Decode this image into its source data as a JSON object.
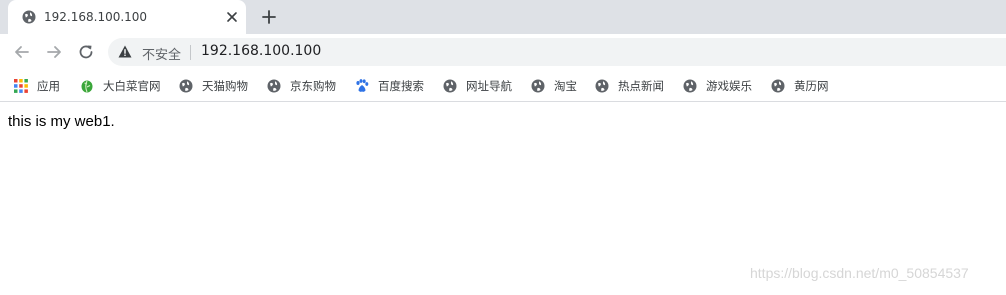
{
  "tab": {
    "title": "192.168.100.100",
    "favicon": "globe-icon"
  },
  "toolbar": {
    "insecure_label": "不安全",
    "url": "192.168.100.100"
  },
  "bookmarks": [
    {
      "label": "应用",
      "icon": "apps-grid-icon"
    },
    {
      "label": "大白菜官网",
      "icon": "cabbage-icon"
    },
    {
      "label": "天猫购物",
      "icon": "globe-icon"
    },
    {
      "label": "京东购物",
      "icon": "globe-icon"
    },
    {
      "label": "百度搜索",
      "icon": "baidu-paw-icon"
    },
    {
      "label": "网址导航",
      "icon": "globe-icon"
    },
    {
      "label": "淘宝",
      "icon": "globe-icon"
    },
    {
      "label": "热点新闻",
      "icon": "globe-icon"
    },
    {
      "label": "游戏娱乐",
      "icon": "globe-icon"
    },
    {
      "label": "黄历网",
      "icon": "globe-icon"
    }
  ],
  "page": {
    "text": "this is my web1."
  },
  "watermark": "https://blog.csdn.net/m0_50854537",
  "colors": {
    "tabstrip": "#dee1e6",
    "omnibox": "#f1f3f4",
    "baidu_blue": "#2f73e6",
    "cabbage_green": "#3aa63a"
  }
}
